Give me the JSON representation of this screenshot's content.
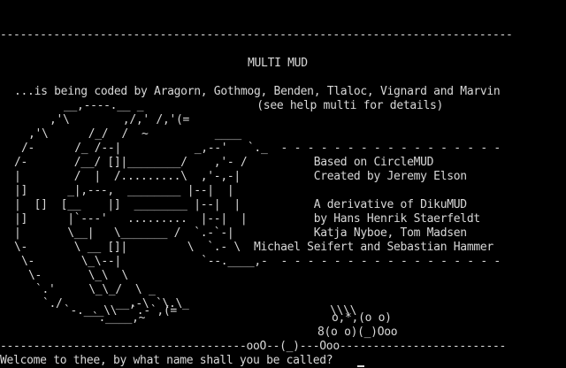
{
  "terminal": {
    "lines": [
      "",
      "",
      "-----------------------------------------------------------------------------",
      "",
      "MULTI MUD",
      "",
      "...is being coded by Aragorn, Gothmog, Benden, Tlaloc, Vignard and Marvin",
      "__,----.__ _                 (see help multi for details)",
      ",'\\        ,/,' /,'(=",
      ",'\\      /_/  /  ~          ____",
      "/-      /_ /--|           _,--'   `._  - - - - - - - - - - - - - - - - -",
      "/-       /__/ []|________/    ,'- /          Based on CircleMUD",
      "|        /  |  /.........\\  ,'-,-|           Created by Jeremy Elson",
      "|]      _|,---,  ________ |--|  |",
      "|  []  [__    |]  ________ |--|  |           A derivative of DikuMUD",
      "|]      |`---'   .........  |--|  |          by Hans Henrik Staerfeldt",
      "|       \\__|   \\_______ /  `.-`-|            Katja Nyboe, Tom Madsen",
      "\\-       \\ __ []|         \\  `.- \\  Michael Seifert and Sebastian Hammer",
      "\\-       \\_\\--|            `--.____,-  - - - - - - - - - - - - - - - - -",
      "\\-       \\_\\  \\",
      "`.'     \\_\\_/  \\ _",
      "`./        __,-\\ `\\.\\_",
      "`-.___\\\\  `.-`,(=                       \\\\\\\\",
      "`.____,~                            o,*,(o o)",
      "                                    8(o o)(_)Ooo",
      "-------------------------------------ooO--(_)---Ooo-------------------------",
      "Welcome to thee, by what name shall you be called?"
    ]
  }
}
